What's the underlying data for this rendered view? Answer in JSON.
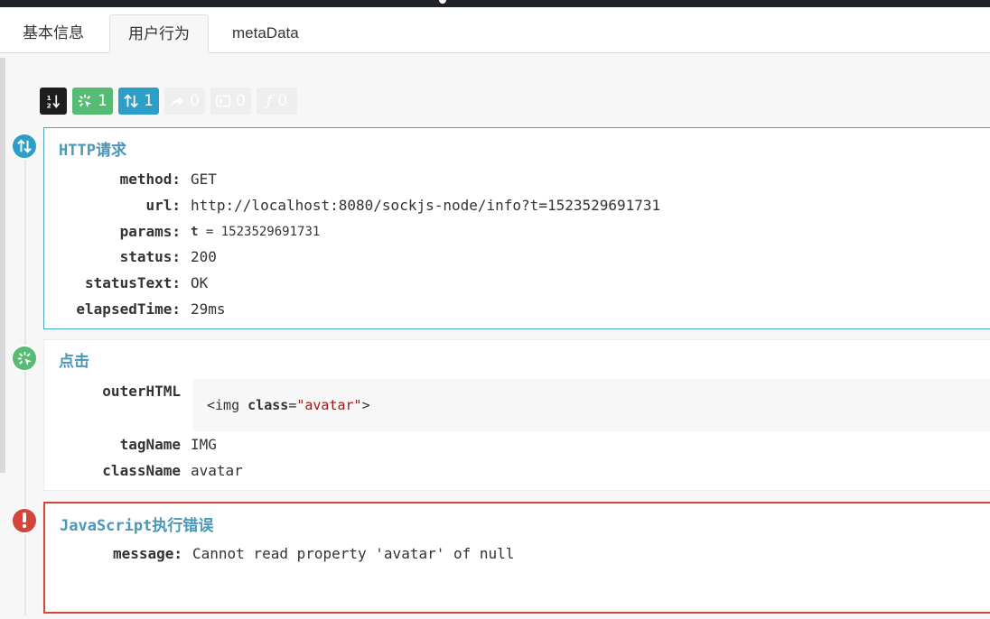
{
  "tabs": [
    {
      "label": "基本信息"
    },
    {
      "label": "用户行为"
    },
    {
      "label": "metaData"
    }
  ],
  "toolbar": {
    "sort_icon": "sort-numeric-icon",
    "click_count": "1",
    "http_count": "1",
    "redirect_count": "0",
    "console_count": "0",
    "function_count": "0"
  },
  "http_card": {
    "title": "HTTP请求",
    "fields": [
      {
        "key": "method:",
        "value": "GET"
      },
      {
        "key": "url:",
        "value": "http://localhost:8080/sockjs-node/info?t=1523529691731"
      },
      {
        "key": "params:",
        "param_name": "t",
        "param_eq": " = ",
        "param_value": "1523529691731"
      },
      {
        "key": "status:",
        "value": "200"
      },
      {
        "key": "statusText:",
        "value": "OK"
      },
      {
        "key": "elapsedTime:",
        "value": "29ms"
      }
    ]
  },
  "click_card": {
    "title": "点击",
    "outer_html_key": "outerHTML",
    "outer_html": {
      "open": "<img ",
      "attr": "class",
      "eq": "=",
      "str": "\"avatar\"",
      "close": ">"
    },
    "tag_name_key": "tagName",
    "tag_name": "IMG",
    "class_name_key": "className",
    "class_name": "avatar"
  },
  "error_card": {
    "title": "JavaScript执行错误",
    "message_key": "message:",
    "message": "Cannot read property 'avatar' of null"
  },
  "colors": {
    "http": "#2f9ec6",
    "click": "#56bb73",
    "error": "#d4453a"
  }
}
